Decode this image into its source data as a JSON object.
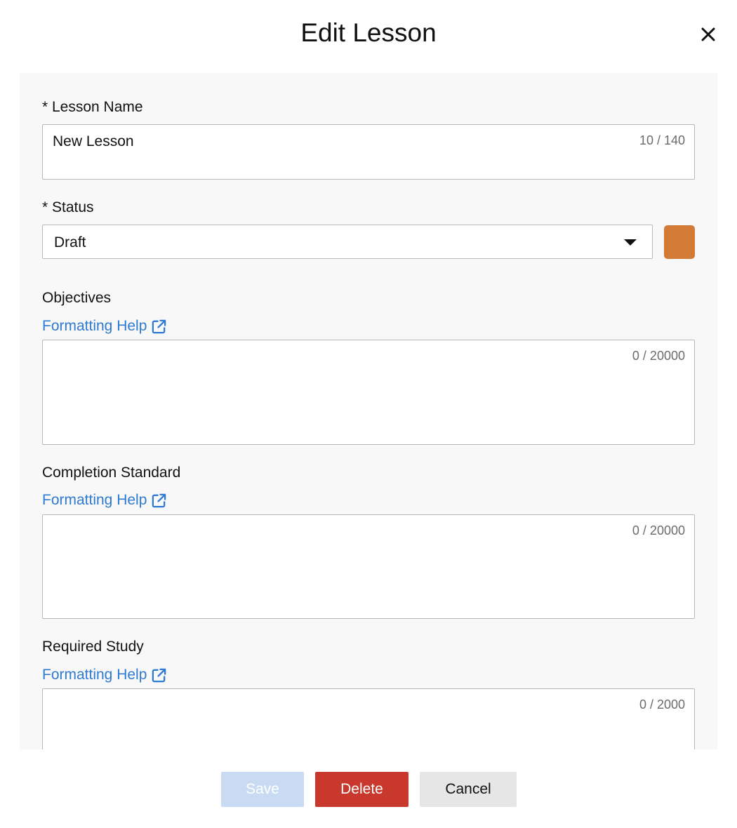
{
  "dialog": {
    "title": "Edit Lesson",
    "close_icon": "close-icon"
  },
  "fields": {
    "lesson_name": {
      "label": "* Lesson Name",
      "value": "New Lesson",
      "counter": "10 / 140"
    },
    "status": {
      "label": "* Status",
      "value": "Draft",
      "color": "#d27a36"
    },
    "objectives": {
      "label": "Objectives",
      "help_link": "Formatting Help",
      "value": "",
      "counter": "0 / 20000"
    },
    "completion_standard": {
      "label": "Completion Standard",
      "help_link": "Formatting Help",
      "value": "",
      "counter": "0 / 20000"
    },
    "required_study": {
      "label": "Required Study",
      "help_link": "Formatting Help",
      "value": "",
      "counter": "0 / 2000"
    }
  },
  "footer": {
    "save_label": "Save",
    "delete_label": "Delete",
    "cancel_label": "Cancel"
  },
  "colors": {
    "link": "#2f7bd1",
    "save_disabled": "#c8dbf2",
    "delete": "#c8382c",
    "cancel": "#e6e6e6",
    "panel_bg": "#f8f8f8"
  }
}
